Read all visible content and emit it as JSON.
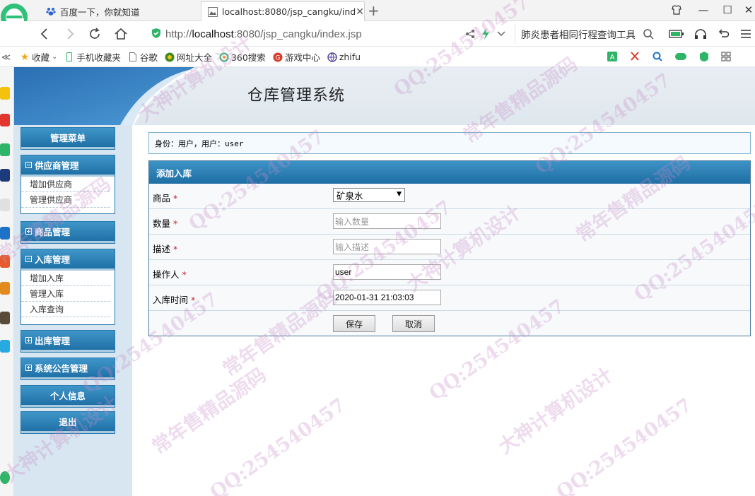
{
  "browser": {
    "tabs": [
      {
        "title": "百度一下，你就知道",
        "active": false
      },
      {
        "title": "localhost:8080/jsp_cangku/ind",
        "active": true
      }
    ],
    "url_prefix": "http://",
    "url_host": "localhost",
    "url_rest": ":8080/jsp_cangku/index.jsp",
    "search_hint": "肺炎患者相同行程查询工具",
    "bookmarks": [
      "收藏",
      "手机收藏夹",
      "谷歌",
      "网址大全",
      "360搜索",
      "游戏中心",
      "zhifu"
    ]
  },
  "page": {
    "title": "仓库管理系统",
    "identity": "身份：用户，用户：user"
  },
  "sidebar": {
    "menu_header": "管理菜单",
    "groups": [
      {
        "label": "供应商管理",
        "expanded": true,
        "items": [
          "增加供应商",
          "管理供应商"
        ]
      },
      {
        "label": "商品管理",
        "expanded": false,
        "items": []
      },
      {
        "label": "入库管理",
        "expanded": true,
        "items": [
          "增加入库",
          "管理入库",
          "入库查询"
        ]
      },
      {
        "label": "出库管理",
        "expanded": false,
        "items": []
      },
      {
        "label": "系统公告管理",
        "expanded": false,
        "items": []
      }
    ],
    "personal": "个人信息",
    "logout": "退出"
  },
  "form": {
    "title": "添加入库",
    "required_mark": "*",
    "fields": [
      {
        "label": "商品",
        "type": "select",
        "value": "矿泉水"
      },
      {
        "label": "数量",
        "type": "text",
        "value": "",
        "placeholder": "输入数量"
      },
      {
        "label": "描述",
        "type": "text",
        "value": "",
        "placeholder": "输入描述"
      },
      {
        "label": "操作人",
        "type": "text",
        "value": "user"
      },
      {
        "label": "入库时间",
        "type": "text",
        "value": "2020-01-31 21:03:03"
      }
    ],
    "save": "保存",
    "cancel": "取消"
  },
  "watermark": [
    "QQ:254540457",
    "大神计算机设计",
    "常年售精品源码"
  ],
  "colors": {
    "menu_blue": "#1f70a6",
    "sidebar_bg": "#d7e6f0",
    "required": "#c0272d",
    "watermark": "#c88cc8"
  }
}
